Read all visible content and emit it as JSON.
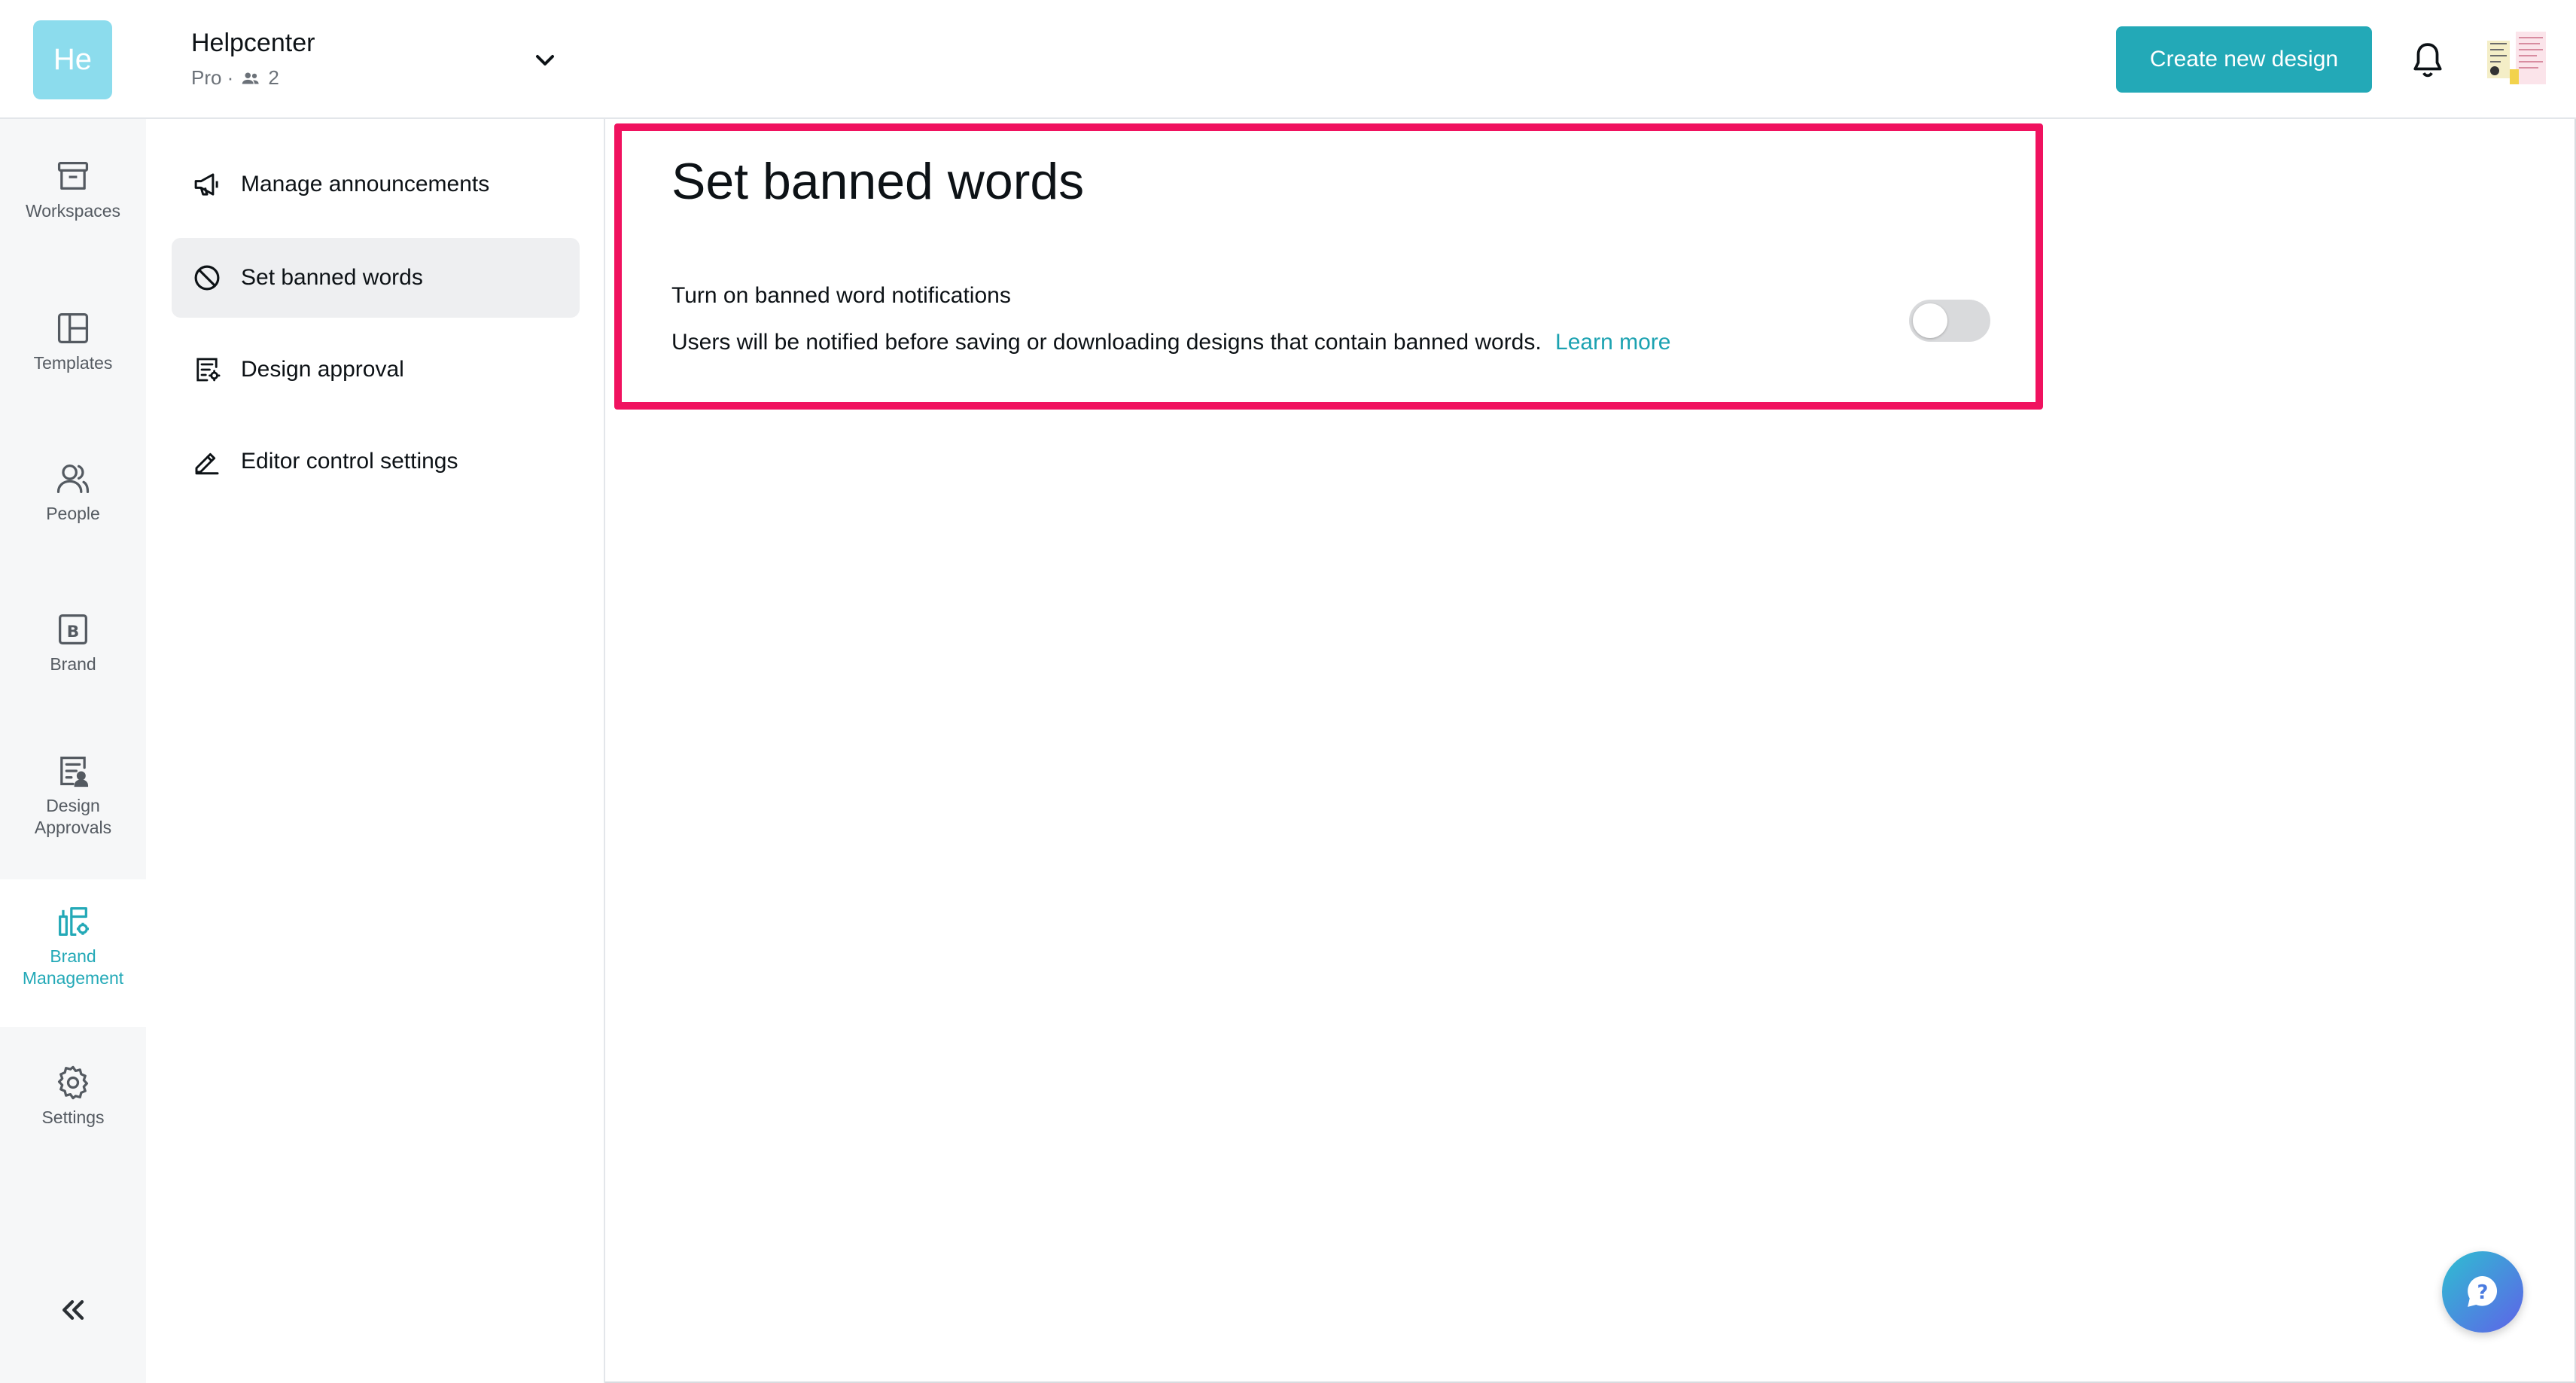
{
  "team": {
    "avatar_text": "He",
    "name": "Helpcenter",
    "plan": "Pro ·",
    "member_count": "2"
  },
  "header": {
    "create_button": "Create new design"
  },
  "rail": {
    "items": [
      {
        "label": "Workspaces",
        "icon": "archive-box-icon"
      },
      {
        "label": "Templates",
        "icon": "layout-grid-icon"
      },
      {
        "label": "People",
        "icon": "people-icon"
      },
      {
        "label": "Brand",
        "icon": "brand-b-icon"
      },
      {
        "label_line1": "Design",
        "label_line2": "Approvals",
        "icon": "design-approval-icon"
      },
      {
        "label_line1": "Brand",
        "label_line2": "Management",
        "icon": "brand-management-icon",
        "active": true
      },
      {
        "label": "Settings",
        "icon": "gear-icon"
      }
    ]
  },
  "subnav": {
    "items": [
      {
        "label": "Manage announcements",
        "icon": "megaphone-icon"
      },
      {
        "label": "Set banned words",
        "icon": "banned-icon",
        "active": true
      },
      {
        "label": "Design approval",
        "icon": "design-approval-icon"
      },
      {
        "label": "Editor control settings",
        "icon": "pencil-icon"
      }
    ]
  },
  "main": {
    "title": "Set banned words",
    "setting": {
      "title": "Turn on banned word notifications",
      "description": "Users will be notified before saving or downloading designs that contain banned words.",
      "learn_more": "Learn more",
      "enabled": false
    }
  },
  "colors": {
    "accent": "#23a9b7",
    "highlight": "#f0125f",
    "team_avatar": "#8cdced"
  }
}
